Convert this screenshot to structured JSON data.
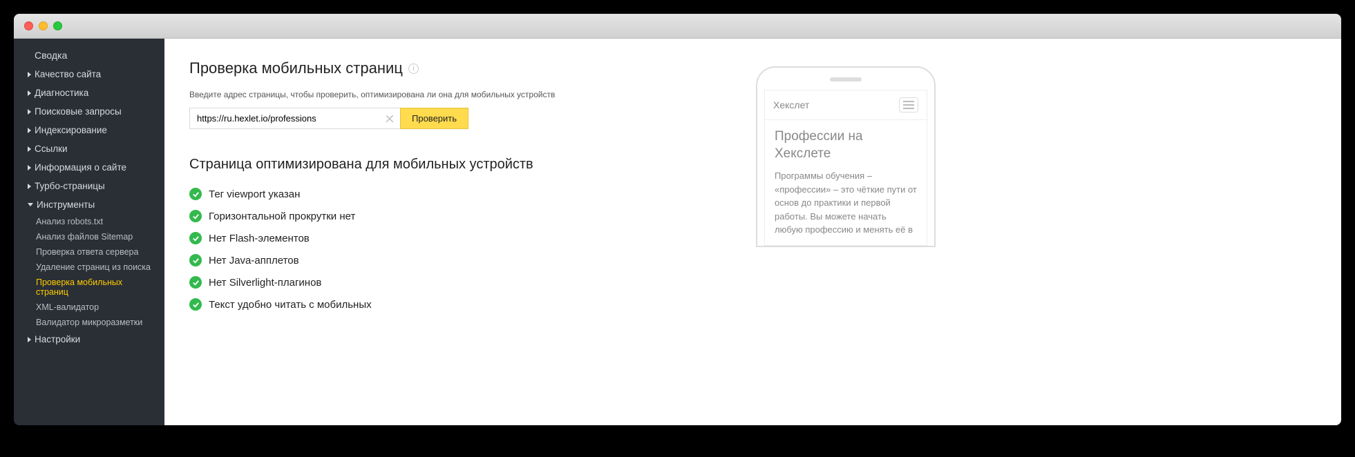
{
  "sidebar": {
    "summary": "Сводка",
    "items": [
      {
        "label": "Качество сайта"
      },
      {
        "label": "Диагностика"
      },
      {
        "label": "Поисковые запросы"
      },
      {
        "label": "Индексирование"
      },
      {
        "label": "Ссылки"
      },
      {
        "label": "Информация о сайте"
      },
      {
        "label": "Турбо-страницы"
      },
      {
        "label": "Инструменты",
        "expanded": true
      },
      {
        "label": "Настройки"
      }
    ],
    "tools_sub": [
      {
        "label": "Анализ robots.txt"
      },
      {
        "label": "Анализ файлов Sitemap"
      },
      {
        "label": "Проверка ответа сервера"
      },
      {
        "label": "Удаление страниц из поиска"
      },
      {
        "label": "Проверка мобильных страниц",
        "active": true
      },
      {
        "label": "XML-валидатор"
      },
      {
        "label": "Валидатор микроразметки"
      }
    ]
  },
  "page": {
    "title": "Проверка мобильных страниц",
    "hint": "Введите адрес страницы, чтобы проверить, оптимизирована ли она для мобильных устройств",
    "url_value": "https://ru.hexlet.io/professions",
    "check_btn": "Проверить",
    "result_title": "Страница оптимизирована для мобильных устройств",
    "checks": [
      "Тег viewport указан",
      "Горизонтальной прокрутки нет",
      "Нет Flash-элементов",
      "Нет Java-апплетов",
      "Нет Silverlight-плагинов",
      "Текст удобно читать с мобильных"
    ]
  },
  "preview": {
    "brand": "Хекслет",
    "heading": "Профессии на Хекслете",
    "paragraph": "Программы обучения – «профессии» – это чёткие пути от основ до практики и первой работы. Вы можете начать любую профессию и менять её в"
  }
}
